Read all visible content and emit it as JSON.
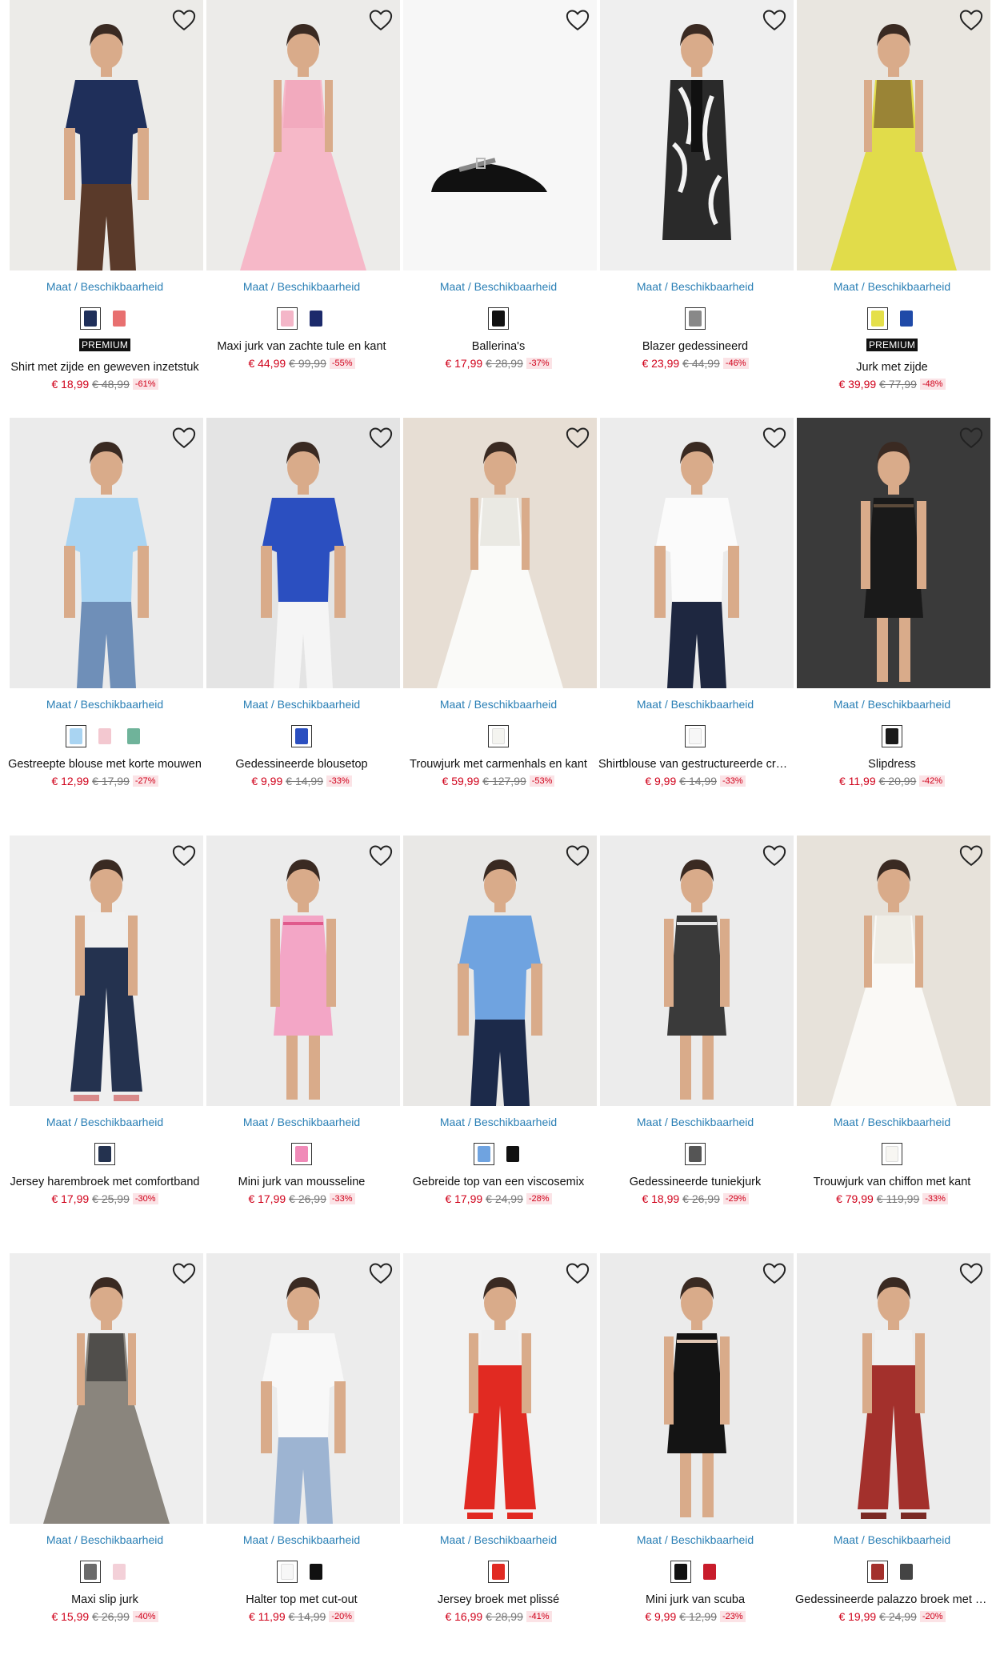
{
  "size_link_label": "Maat / Beschikbaarheid",
  "colors": {
    "link": "#2a7fb5",
    "price": "#d0021b",
    "discount_bg": "#fbe3e6"
  },
  "products": [
    {
      "name": "Shirt met zijde en geweven inzetstuk",
      "price": "€ 18,99",
      "old_price": "€ 48,99",
      "discount": "-61%",
      "badge": "PREMIUM",
      "swatches": [
        "#1f2f5a",
        "#e87070"
      ]
    },
    {
      "name": "Maxi jurk van zachte tule en kant",
      "price": "€ 44,99",
      "old_price": "€ 99,99",
      "discount": "-55%",
      "badge": "",
      "swatches": [
        "#f4b6c8",
        "#1c2a6b"
      ]
    },
    {
      "name": "Ballerina's",
      "price": "€ 17,99",
      "old_price": "€ 28,99",
      "discount": "-37%",
      "badge": "",
      "swatches": [
        "#111111"
      ]
    },
    {
      "name": "Blazer gedessineerd",
      "price": "€ 23,99",
      "old_price": "€ 44,99",
      "discount": "-46%",
      "badge": "",
      "swatches": [
        "#888888"
      ]
    },
    {
      "name": "Jurk met zijde",
      "price": "€ 39,99",
      "old_price": "€ 77,99",
      "discount": "-48%",
      "badge": "PREMIUM",
      "swatches": [
        "#e5e04a",
        "#1f4aa8"
      ]
    },
    {
      "name": "Gestreepte blouse met korte mouwen",
      "price": "€ 12,99",
      "old_price": "€ 17,99",
      "discount": "-27%",
      "badge": "",
      "swatches": [
        "#a9d4f2",
        "#f3c8d0",
        "#6fb39a"
      ]
    },
    {
      "name": "Gedessineerde blousetop",
      "price": "€ 9,99",
      "old_price": "€ 14,99",
      "discount": "-33%",
      "badge": "",
      "swatches": [
        "#2b4fc0"
      ]
    },
    {
      "name": "Trouwjurk met carmenhals en kant",
      "price": "€ 59,99",
      "old_price": "€ 127,99",
      "discount": "-53%",
      "badge": "",
      "swatches": [
        "#f4f4f0"
      ]
    },
    {
      "name": "Shirtblouse van gestructureerde crêpe",
      "price": "€ 9,99",
      "old_price": "€ 14,99",
      "discount": "-33%",
      "badge": "",
      "swatches": [
        "#f7f7f7"
      ]
    },
    {
      "name": "Slipdress",
      "price": "€ 11,99",
      "old_price": "€ 20,99",
      "discount": "-42%",
      "badge": "",
      "swatches": [
        "#1a1a1a"
      ]
    },
    {
      "name": "Jersey harembroek met comfortband",
      "price": "€ 17,99",
      "old_price": "€ 25,99",
      "discount": "-30%",
      "badge": "",
      "swatches": [
        "#24324f"
      ]
    },
    {
      "name": "Mini jurk van mousseline",
      "price": "€ 17,99",
      "old_price": "€ 26,99",
      "discount": "-33%",
      "badge": "",
      "swatches": [
        "#f08ab8"
      ]
    },
    {
      "name": "Gebreide top van een viscosemix",
      "price": "€ 17,99",
      "old_price": "€ 24,99",
      "discount": "-28%",
      "badge": "",
      "swatches": [
        "#6fa3e0",
        "#111111"
      ]
    },
    {
      "name": "Gedessineerde tuniekjurk",
      "price": "€ 18,99",
      "old_price": "€ 26,99",
      "discount": "-29%",
      "badge": "",
      "swatches": [
        "#555555"
      ]
    },
    {
      "name": "Trouwjurk van chiffon met kant",
      "price": "€ 79,99",
      "old_price": "€ 119,99",
      "discount": "-33%",
      "badge": "",
      "swatches": [
        "#f7f6f2"
      ]
    },
    {
      "name": "Maxi slip jurk",
      "price": "€ 15,99",
      "old_price": "€ 26,99",
      "discount": "-40%",
      "badge": "",
      "swatches": [
        "#6b6b6b",
        "#f3d0d8"
      ]
    },
    {
      "name": "Halter top met cut-out",
      "price": "€ 11,99",
      "old_price": "€ 14,99",
      "discount": "-20%",
      "badge": "",
      "swatches": [
        "#f7f7f7",
        "#111111"
      ]
    },
    {
      "name": "Jersey broek met plissé",
      "price": "€ 16,99",
      "old_price": "€ 28,99",
      "discount": "-41%",
      "badge": "",
      "swatches": [
        "#e12a22"
      ]
    },
    {
      "name": "Mini jurk van scuba",
      "price": "€ 9,99",
      "old_price": "€ 12,99",
      "discount": "-23%",
      "badge": "",
      "swatches": [
        "#111111",
        "#c81c2b"
      ]
    },
    {
      "name": "Gedessineerde palazzo broek met comfortband",
      "price": "€ 19,99",
      "old_price": "€ 24,99",
      "discount": "-20%",
      "badge": "",
      "swatches": [
        "#a3302c",
        "#444444"
      ]
    }
  ],
  "images": [
    {
      "bg": "#ecebe8",
      "main": "#1f2f5a",
      "accent": "#5a3a2a",
      "kind": "top"
    },
    {
      "bg": "#ecebe9",
      "main": "#f6b8c8",
      "accent": "#f0a0b8",
      "kind": "gown"
    },
    {
      "bg": "#f7f7f7",
      "main": "#111111",
      "accent": "#888888",
      "kind": "shoe"
    },
    {
      "bg": "#efefef",
      "main": "#2a2a2a",
      "accent": "#f3f3f3",
      "kind": "blazer"
    },
    {
      "bg": "#e9e6e0",
      "main": "#e1dc4a",
      "accent": "#6b4a2a",
      "kind": "gown"
    },
    {
      "bg": "#ebebeb",
      "main": "#a9d4f2",
      "accent": "#6f8fb8",
      "kind": "top"
    },
    {
      "bg": "#e4e4e4",
      "main": "#2b4fc0",
      "accent": "#f5f5f5",
      "kind": "top"
    },
    {
      "bg": "#e7ded4",
      "main": "#fafaf8",
      "accent": "#e0ddd5",
      "kind": "gown"
    },
    {
      "bg": "#ececec",
      "main": "#fbfbfb",
      "accent": "#1e2740",
      "kind": "top"
    },
    {
      "bg": "#3a3a3a",
      "main": "#1a1a1a",
      "accent": "#5b4a3a",
      "kind": "dress"
    },
    {
      "bg": "#efefef",
      "main": "#24324f",
      "accent": "#d98a8a",
      "kind": "pants"
    },
    {
      "bg": "#ececec",
      "main": "#f3a6c6",
      "accent": "#e05a8c",
      "kind": "dress"
    },
    {
      "bg": "#e9e8e6",
      "main": "#6fa3e0",
      "accent": "#1c2a4a",
      "kind": "top"
    },
    {
      "bg": "#ececec",
      "main": "#3a3a3a",
      "accent": "#e5e5e5",
      "kind": "dress"
    },
    {
      "bg": "#e7e2da",
      "main": "#faf9f6",
      "accent": "#e8e4dc",
      "kind": "gown"
    },
    {
      "bg": "#eeeeee",
      "main": "#8a857d",
      "accent": "#2a2a2a",
      "kind": "gown"
    },
    {
      "bg": "#ececec",
      "main": "#f8f8f8",
      "accent": "#9db4d2",
      "kind": "top"
    },
    {
      "bg": "#f2f2f2",
      "main": "#e12a22",
      "accent": "#e12a22",
      "kind": "pants"
    },
    {
      "bg": "#ebebeb",
      "main": "#141414",
      "accent": "#e2c8b5",
      "kind": "dress"
    },
    {
      "bg": "#ececec",
      "main": "#a3302c",
      "accent": "#7a2a25",
      "kind": "pants"
    }
  ]
}
